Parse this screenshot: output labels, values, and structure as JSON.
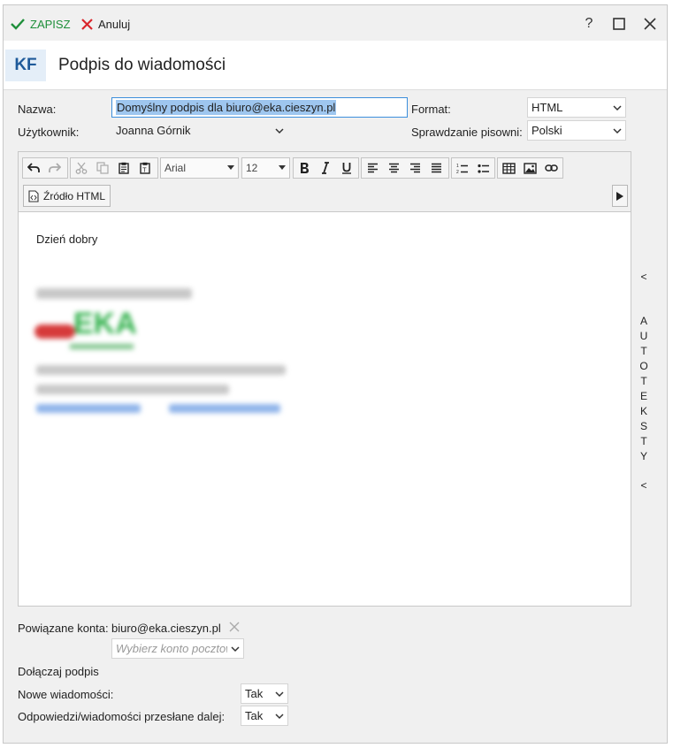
{
  "toolbar": {
    "save_label": "ZAPISZ",
    "cancel_label": "Anuluj",
    "help_label": "?"
  },
  "header": {
    "avatar": "KF",
    "title": "Podpis do wiadomości"
  },
  "form": {
    "name_label": "Nazwa:",
    "name_value": "Domyślny podpis dla biuro@eka.cieszyn.pl",
    "user_label": "Użytkownik:",
    "user_value": "Joanna Górnik",
    "format_label": "Format:",
    "format_value": "HTML",
    "spell_label": "Sprawdzanie pisowni:",
    "spell_value": "Polski"
  },
  "editor": {
    "font_value": "Arial",
    "size_value": "12",
    "source_label": "Źródło HTML",
    "greeting": "Dzień dobry",
    "logo_text": "EKA"
  },
  "side_panel": {
    "top_arrow": "<",
    "letters": [
      "A",
      "U",
      "T",
      "O",
      "T",
      "E",
      "K",
      "S",
      "T",
      "Y"
    ],
    "bottom_arrow": "<"
  },
  "linked": {
    "label": "Powiązane konta:",
    "account": "biuro@eka.cieszyn.pl",
    "picker_placeholder": "Wybierz konto pocztowe"
  },
  "attach": {
    "heading": "Dołączaj podpis",
    "new_label": "Nowe wiadomości:",
    "new_value": "Tak",
    "reply_label": "Odpowiedzi/wiadomości przesłane dalej:",
    "reply_value": "Tak"
  },
  "colors": {
    "accent_green": "#1e8f3a",
    "cancel_red": "#d9262c",
    "selection": "#9ec6ef",
    "link_blue": "#2a6fd6"
  }
}
